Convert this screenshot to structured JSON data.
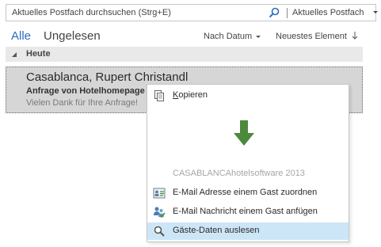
{
  "search": {
    "placeholder": "Aktuelles Postfach durchsuchen (Strg+E)",
    "scope_label": "Aktuelles Postfach"
  },
  "filters": {
    "all_label": "Alle",
    "unread_label": "Ungelesen",
    "sort_by_label": "Nach Datum",
    "sort_order_label": "Neuestes Element"
  },
  "group": {
    "label": "Heute"
  },
  "mail": {
    "sender": "Casablanca, Rupert Christandl",
    "subject": "Anfrage von Hotelhomepage",
    "preview": "Vielen Dank für Ihre Anfrage!"
  },
  "context_menu": {
    "copy_prefix": "",
    "copy_accel": "K",
    "copy_rest": "opieren",
    "group_title": "CASABLANCAhotelsoftware 2013",
    "items": [
      {
        "label": "E-Mail Adresse einem Gast zuordnen",
        "icon": "address-card-icon"
      },
      {
        "label": "E-Mail Nachricht einem Gast anfügen",
        "icon": "users-attach-icon"
      },
      {
        "label": "Gäste-Daten auslesen",
        "icon": "magnifier-icon"
      }
    ]
  },
  "colors": {
    "accent": "#2b6cc4",
    "selected_item_bg": "#d6d6d6",
    "menu_highlight": "#cde6f7",
    "arrow_green": "#4b8a3c"
  }
}
